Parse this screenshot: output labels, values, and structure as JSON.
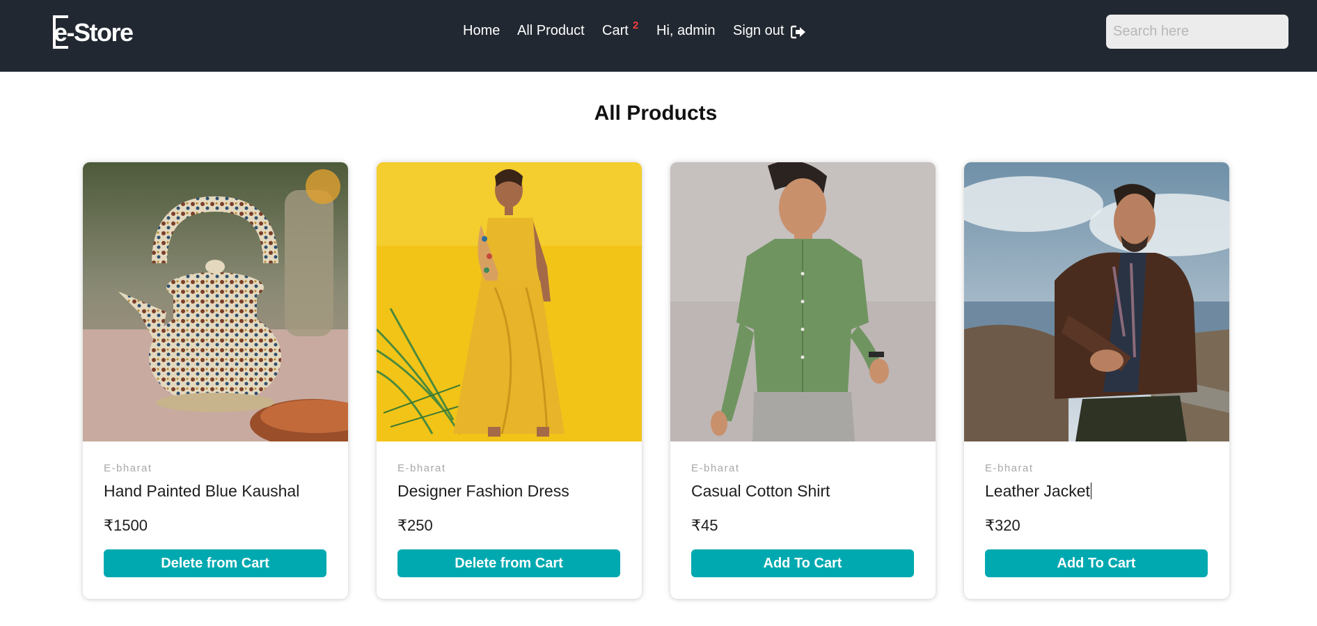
{
  "brand": {
    "logo_text": "e-Store"
  },
  "nav": {
    "home": "Home",
    "all_product": "All Product",
    "cart": "Cart",
    "cart_count": "2",
    "greeting": "Hi, admin",
    "sign_out": "Sign out"
  },
  "search": {
    "placeholder": "Search here",
    "value": ""
  },
  "page": {
    "title": "All Products"
  },
  "products": [
    {
      "brand": "E-bharat",
      "name": "Hand Painted Blue Kaushal",
      "price": "₹1500",
      "button": "Delete from Cart",
      "image": "painted-kettle-photo"
    },
    {
      "brand": "E-bharat",
      "name": "Designer Fashion Dress",
      "price": "₹250",
      "button": "Delete from Cart",
      "image": "yellow-dress-photo"
    },
    {
      "brand": "E-bharat",
      "name": "Casual Cotton Shirt",
      "price": "₹45",
      "button": "Add To Cart",
      "image": "green-shirt-photo"
    },
    {
      "brand": "E-bharat",
      "name": "Leather Jacket",
      "price": "₹320",
      "button": "Add To Cart",
      "image": "leather-jacket-photo"
    }
  ],
  "colors": {
    "navbar": "#222831",
    "accent": "#00a9b0",
    "badge": "#ff3b3b"
  },
  "icons": {
    "sign_out": "sign-out-icon"
  }
}
